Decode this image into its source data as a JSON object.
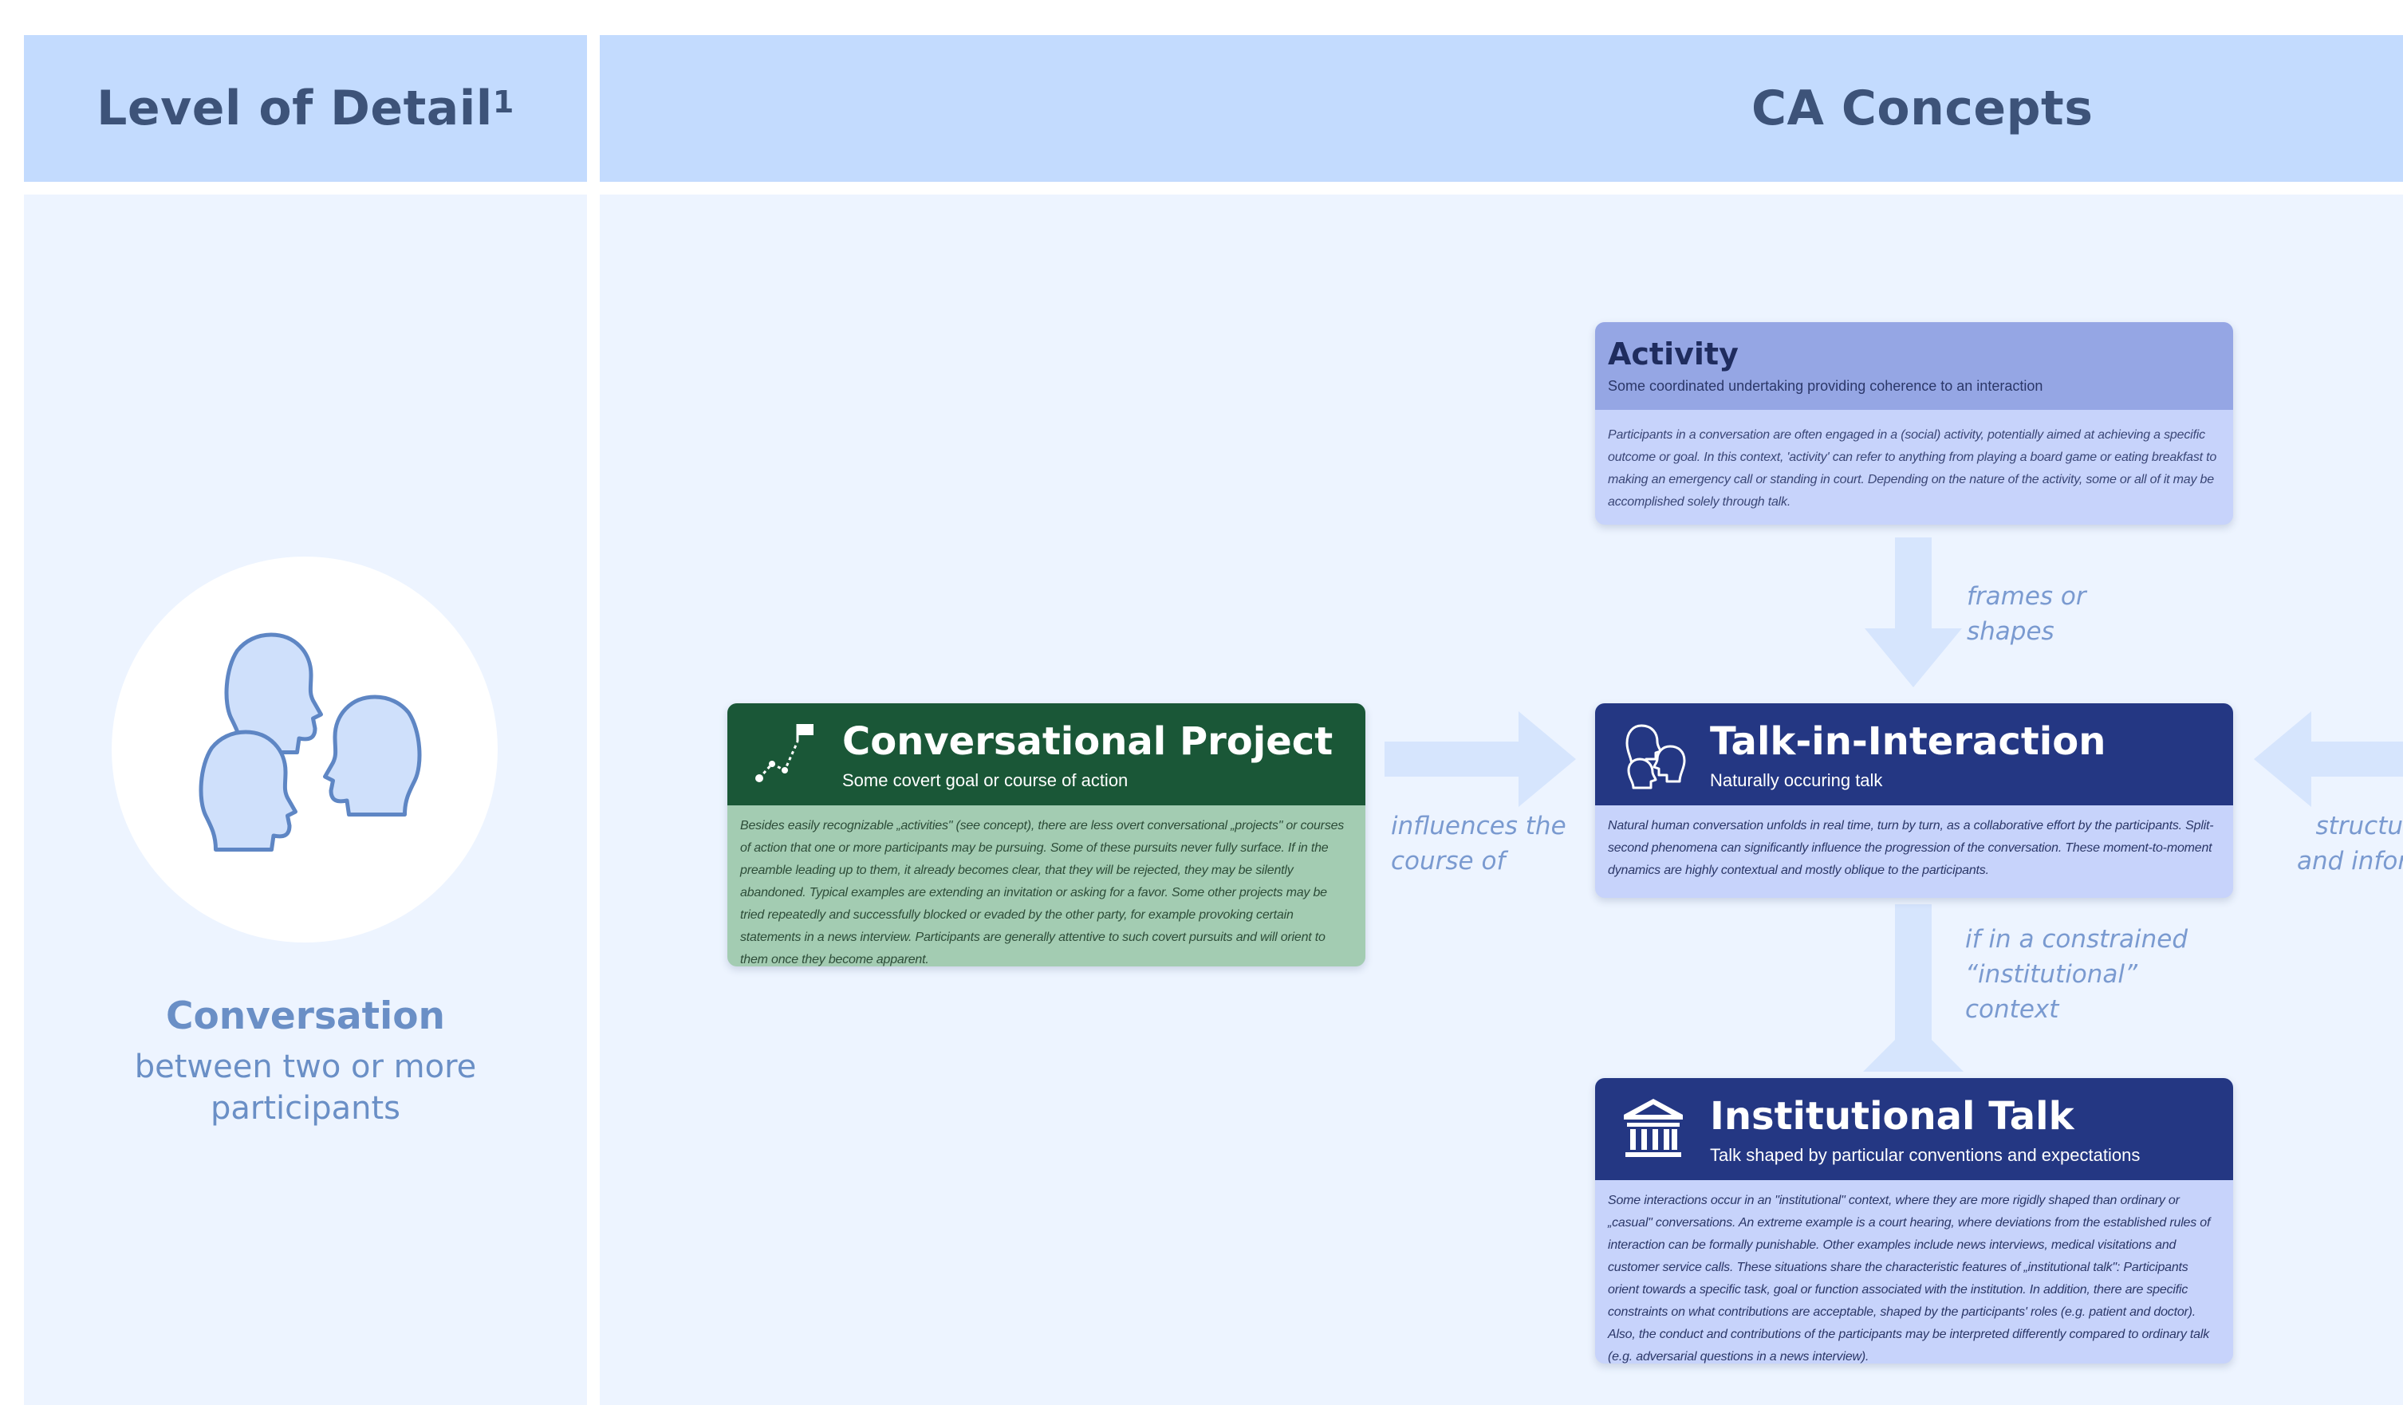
{
  "headers": {
    "level": "Level of Detail",
    "level_sup": "1",
    "concepts": "CA Concepts"
  },
  "level": {
    "title": "Conversation",
    "subtitle_line1": "between two or more",
    "subtitle_line2": "participants",
    "icon": "people-heads-icon"
  },
  "colors": {
    "header_bg": "#c3dbfe",
    "column_bg": "#edf4ff",
    "header_text": "#3d5379",
    "arrow": "#d6e5fd",
    "activity_head": "#95a6e4",
    "project_head": "#1a5737",
    "project_body": "#a3ccb2",
    "talk_head": "#243783",
    "box_body": "#c7d3fb"
  },
  "activity": {
    "title": "Activity",
    "subtitle": "Some coordinated undertaking providing coherence to an interaction",
    "body": "Participants in a conversation are often engaged in a (social) activity, potentially aimed at achieving a specific outcome or goal. In this context, 'activity' can refer to anything from playing a board game or eating breakfast to making an emergency call or standing in court. Depending on the nature of the activity, some or all of it may be accomplished solely through talk."
  },
  "project": {
    "title": "Conversational Project",
    "subtitle": "Some covert goal or course of action",
    "icon": "path-flag-icon",
    "body": "Besides easily recognizable „activities\" (see concept), there are less overt conversational „projects\" or courses of action that one or more participants may be pursuing. Some of these pursuits never fully surface. If in the preamble leading up to them, it already becomes clear, that they will be rejected, they may be silently abandoned. Typical examples are extending an invitation or asking for a favor. Some other projects may be tried repeatedly and successfully blocked or evaded by the other party, for example provoking certain statements in a news interview. Participants are generally attentive to such covert pursuits and will orient to them once they become apparent."
  },
  "talk": {
    "title": "Talk-in-Interaction",
    "subtitle": "Naturally occuring talk",
    "icon": "talking-heads-icon",
    "body": "Natural human conversation unfolds in real time, turn by turn, as a collaborative effort by the participants. Split-second phenomena can significantly influence the progression of the conversation. These moment-to-moment dynamics are highly contextual and mostly oblique to the participants."
  },
  "institutional": {
    "title": "Institutional Talk",
    "subtitle": "Talk shaped by particular conventions and expectations",
    "icon": "institution-building-icon",
    "body": "Some interactions occur in an \"institutional\" context, where they are more rigidly shaped than ordinary or „casual\" conversations. An extreme example is a court hearing, where deviations from the established rules of interaction can be formally punishable. Other examples include news interviews, medical visitations and customer service calls. These situations share the characteristic features of „institutional talk\": Participants orient towards a specific task, goal or function associated with the institution. In addition, there are specific constraints on what contributions are acceptable, shaped by the participants' roles (e.g. patient and doctor). Also, the conduct and contributions of the participants may be interpreted differently compared to ordinary talk (e.g. adversarial questions in a news interview)."
  },
  "labels": {
    "frames_1": "frames or",
    "frames_2": "shapes",
    "influences_1": "influences the",
    "influences_2": "course of",
    "constrained_1": "if in a constrained",
    "constrained_2": "“institutional”",
    "constrained_3": "context",
    "right_1": "structu",
    "right_2": "and infor"
  }
}
